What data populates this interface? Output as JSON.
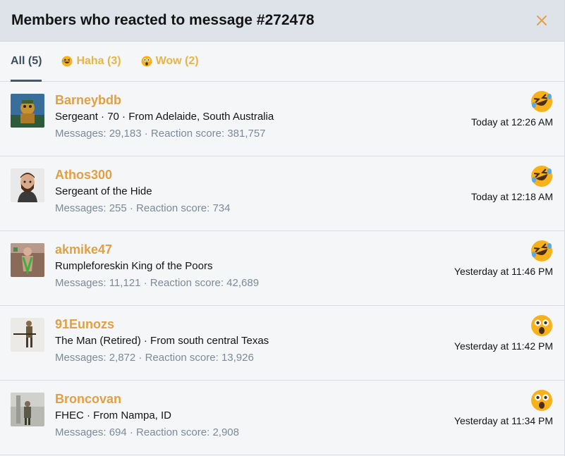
{
  "header": {
    "title": "Members who reacted to message #272478",
    "close_icon": "close-icon"
  },
  "colors": {
    "accent": "#e0a044",
    "header_bg": "#dee3ea",
    "muted": "#7b8a9a",
    "active_tab": "#47566a"
  },
  "tabs": [
    {
      "label": "All (5)",
      "icon": ""
    },
    {
      "label": "Haha (3)",
      "icon": "haha-emoji-icon"
    },
    {
      "label": "Wow (2)",
      "icon": "wow-emoji-icon"
    }
  ],
  "members": [
    {
      "username": "Barneybdb",
      "title": "Sergeant · 70 · From Adelaide, South Australia",
      "stats": "Messages: 29,183 · Reaction score: 381,757",
      "reaction": "haha",
      "time": "Today at 12:26 AM"
    },
    {
      "username": "Athos300",
      "title": "Sergeant of the Hide",
      "stats": "Messages: 255 · Reaction score: 734",
      "reaction": "haha",
      "time": "Today at 12:18 AM"
    },
    {
      "username": "akmike47",
      "title": "Rumpleforeskin King of the Poors",
      "stats": "Messages: 11,121 · Reaction score: 42,689",
      "reaction": "haha",
      "time": "Yesterday at 11:46 PM"
    },
    {
      "username": "91Eunozs",
      "title": "The Man (Retired) · From south central Texas",
      "stats": "Messages: 2,872 · Reaction score: 13,926",
      "reaction": "wow",
      "time": "Yesterday at 11:42 PM"
    },
    {
      "username": "Broncovan",
      "title": "FHEC · From Nampa, ID",
      "stats": "Messages: 694 · Reaction score: 2,908",
      "reaction": "wow",
      "time": "Yesterday at 11:34 PM"
    }
  ]
}
